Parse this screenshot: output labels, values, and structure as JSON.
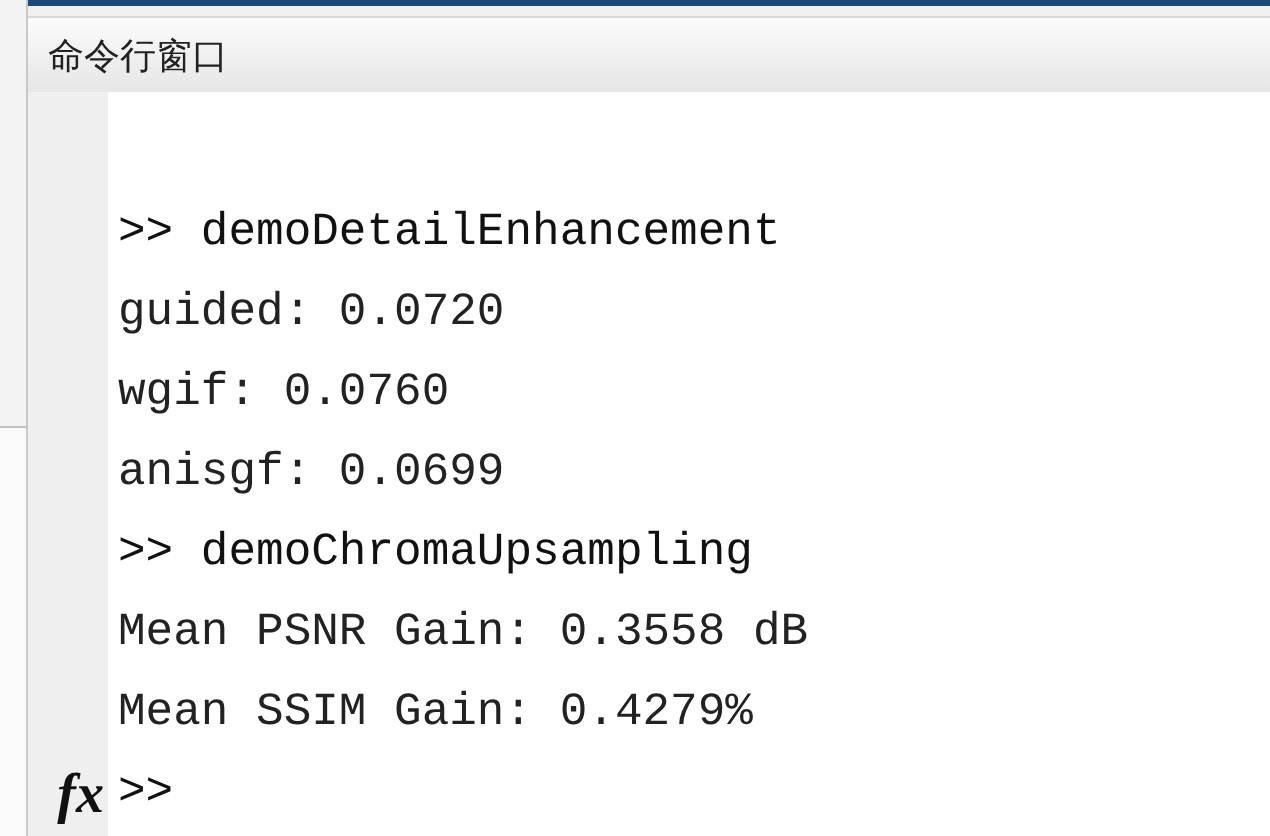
{
  "panel": {
    "title": "命令行窗口"
  },
  "lines": [
    {
      "kind": "command",
      "text": ">> demoDetailEnhancement"
    },
    {
      "kind": "output",
      "text": "guided: 0.0720"
    },
    {
      "kind": "output",
      "text": "wgif: 0.0760"
    },
    {
      "kind": "output",
      "text": "anisgf: 0.0699"
    },
    {
      "kind": "command",
      "text": ">> demoChromaUpsampling"
    },
    {
      "kind": "output",
      "text": "Mean PSNR Gain: 0.3558 dB"
    },
    {
      "kind": "output",
      "text": "Mean SSIM Gain: 0.4279%"
    }
  ],
  "input": {
    "function_button": "fx",
    "prompt": ">>"
  }
}
